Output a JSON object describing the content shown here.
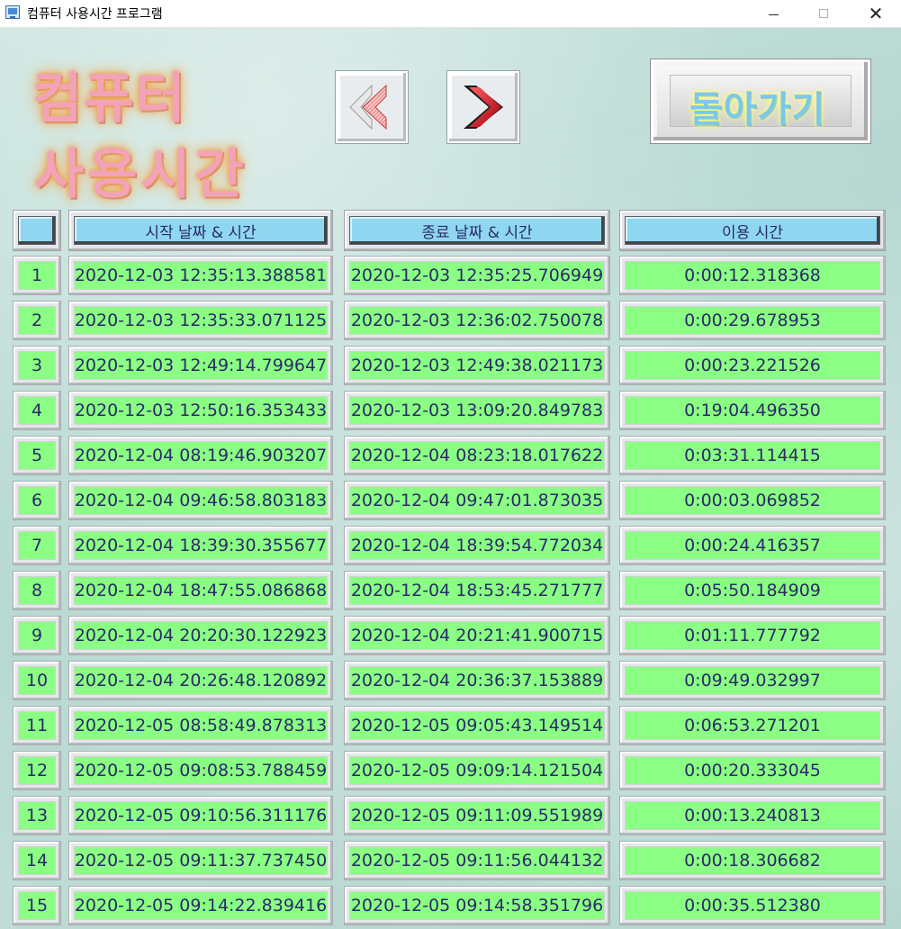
{
  "window": {
    "title": "컴퓨터 사용시간 프로그램",
    "icon": "monitor-app-icon"
  },
  "logo": {
    "line1": "컴퓨터",
    "line2": "사용시간"
  },
  "nav": {
    "prev_icon": "chevron-left-icon",
    "next_icon": "chevron-right-icon"
  },
  "back_button": {
    "label": "돌아가기"
  },
  "table": {
    "headers": [
      "",
      "시작 날짜 & 시간",
      "종료 날짜 & 시간",
      "이용 시간"
    ],
    "rows": [
      {
        "idx": "1",
        "start": "2020-12-03 12:35:13.388581",
        "end": "2020-12-03 12:35:25.706949",
        "duration": "0:00:12.318368"
      },
      {
        "idx": "2",
        "start": "2020-12-03 12:35:33.071125",
        "end": "2020-12-03 12:36:02.750078",
        "duration": "0:00:29.678953"
      },
      {
        "idx": "3",
        "start": "2020-12-03 12:49:14.799647",
        "end": "2020-12-03 12:49:38.021173",
        "duration": "0:00:23.221526"
      },
      {
        "idx": "4",
        "start": "2020-12-03 12:50:16.353433",
        "end": "2020-12-03 13:09:20.849783",
        "duration": "0:19:04.496350"
      },
      {
        "idx": "5",
        "start": "2020-12-04 08:19:46.903207",
        "end": "2020-12-04 08:23:18.017622",
        "duration": "0:03:31.114415"
      },
      {
        "idx": "6",
        "start": "2020-12-04 09:46:58.803183",
        "end": "2020-12-04 09:47:01.873035",
        "duration": "0:00:03.069852"
      },
      {
        "idx": "7",
        "start": "2020-12-04 18:39:30.355677",
        "end": "2020-12-04 18:39:54.772034",
        "duration": "0:00:24.416357"
      },
      {
        "idx": "8",
        "start": "2020-12-04 18:47:55.086868",
        "end": "2020-12-04 18:53:45.271777",
        "duration": "0:05:50.184909"
      },
      {
        "idx": "9",
        "start": "2020-12-04 20:20:30.122923",
        "end": "2020-12-04 20:21:41.900715",
        "duration": "0:01:11.777792"
      },
      {
        "idx": "10",
        "start": "2020-12-04 20:26:48.120892",
        "end": "2020-12-04 20:36:37.153889",
        "duration": "0:09:49.032997"
      },
      {
        "idx": "11",
        "start": "2020-12-05 08:58:49.878313",
        "end": "2020-12-05 09:05:43.149514",
        "duration": "0:06:53.271201"
      },
      {
        "idx": "12",
        "start": "2020-12-05 09:08:53.788459",
        "end": "2020-12-05 09:09:14.121504",
        "duration": "0:00:20.333045"
      },
      {
        "idx": "13",
        "start": "2020-12-05 09:10:56.311176",
        "end": "2020-12-05 09:11:09.551989",
        "duration": "0:00:13.240813"
      },
      {
        "idx": "14",
        "start": "2020-12-05 09:11:37.737450",
        "end": "2020-12-05 09:11:56.044132",
        "duration": "0:00:18.306682"
      },
      {
        "idx": "15",
        "start": "2020-12-05 09:14:22.839416",
        "end": "2020-12-05 09:14:58.351796",
        "duration": "0:00:35.512380"
      }
    ]
  }
}
